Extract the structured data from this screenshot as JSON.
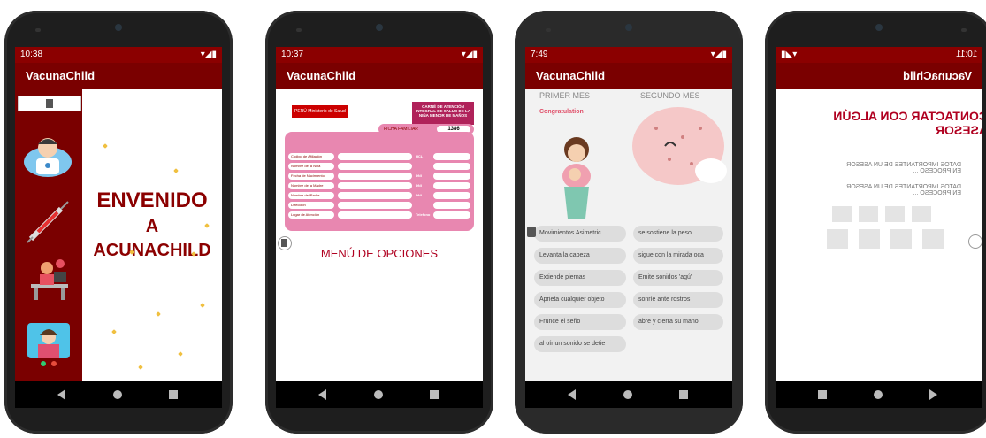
{
  "app_title": "VacunaChild",
  "phones": [
    {
      "time": "10:38",
      "status_icons": "▾◢▮"
    },
    {
      "time": "10:37",
      "status_icons": "▾◢▮"
    },
    {
      "time": "7:49",
      "status_icons": "▾◢▮"
    },
    {
      "time": "10:11",
      "status_icons": "▮◣▾"
    }
  ],
  "welcome": {
    "line1": "ENVENIDO",
    "line2": "A",
    "line3": "ACUNACHILD"
  },
  "card": {
    "header": "CARNÉ DE ATENCIÓN INTEGRAL DE SALUD DE LA NIÑA MENOR DE 5 AÑOS",
    "ficha_label": "FICHA FAMILIAR",
    "ficha_value": "1386",
    "fields": [
      "Codigo de Afiliación",
      "Nombre de la Niña",
      "Fecha de Nacimiento",
      "Nombre de la Madre",
      "Nombre del Padre",
      "Dirección",
      "Lugar de Atención"
    ],
    "right_labels": [
      "HCL",
      "",
      "DNI",
      "DNI",
      "DNI",
      "",
      "Telefono"
    ],
    "logo": "PERÚ  Ministerio de Salud"
  },
  "menu_label": "MENÚ DE OPCIONES",
  "months": {
    "first": "PRIMER MES",
    "second": "SEGUNDO MES",
    "congrats": "Congratulation"
  },
  "milestones": [
    [
      "Movimientos Asimetric",
      "se sostiene la peso"
    ],
    [
      "Levanta la cabeza",
      "sigue con la mirada oca"
    ],
    [
      "Extiende piernas",
      "Emite sonidos 'agú'"
    ],
    [
      "Aprieta cualquier objeto",
      "sonríe ante rostros"
    ],
    [
      "Frunce el seño",
      "abre y cierra su mano"
    ],
    [
      "al oír un sonido se detie",
      ""
    ]
  ],
  "advisor": {
    "title": "CONTACTAR CON ALGÚN ASESOR",
    "msg1": "DATOS IMPORTANTES DE UN ASESOR EN PROCESO ...",
    "msg2": "DATOS IMPORTANTES DE UN ASESOR EN PROCESO ..."
  }
}
